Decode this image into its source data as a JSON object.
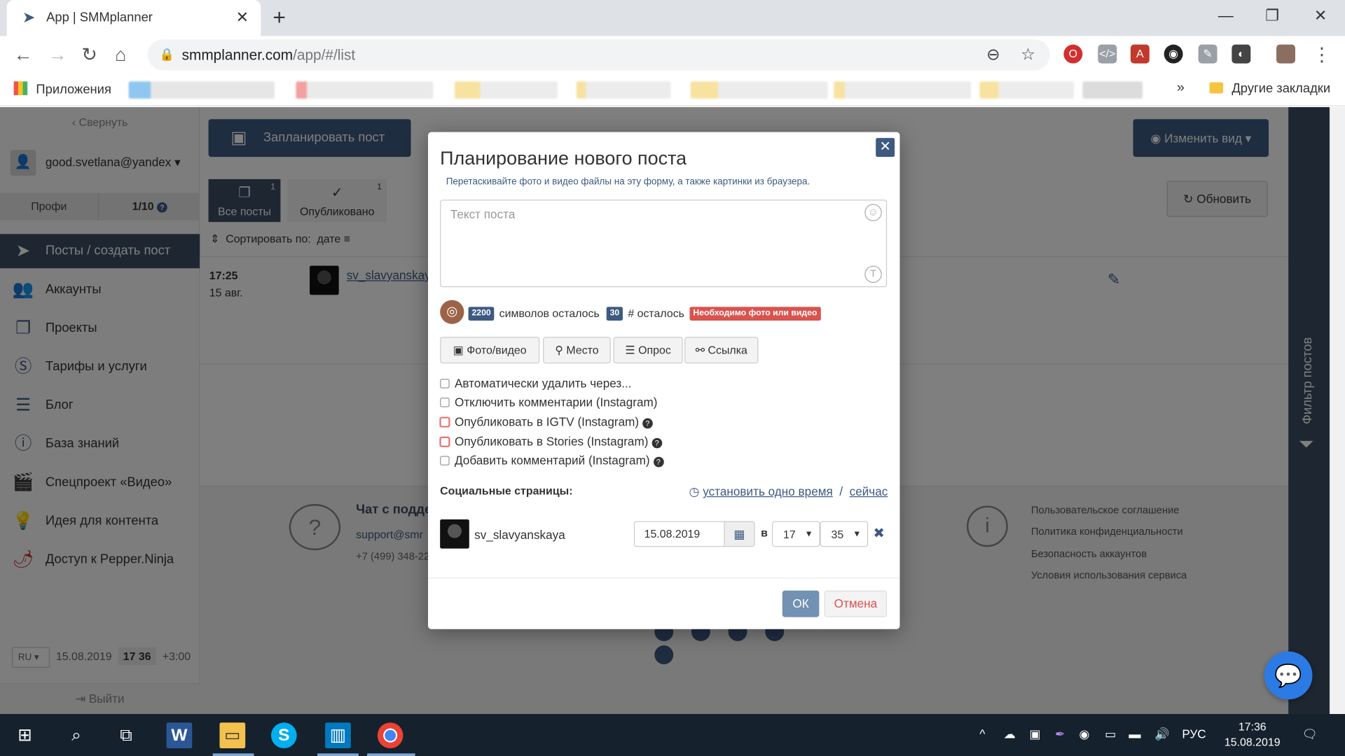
{
  "browser": {
    "tab_title": "App | SMMplanner",
    "url_host": "smmplanner.com",
    "url_path": "/app/#/list",
    "bookmarks": {
      "apps": "Приложения",
      "more": "»",
      "other": "Другие закладки"
    }
  },
  "sidebar": {
    "collapse": "Свернуть",
    "user": "good.svetlana@yandex",
    "plan_name": "Профи",
    "plan_count": "1/10",
    "menu": [
      {
        "label": "Посты / создать пост",
        "icon": "paper-plane-icon"
      },
      {
        "label": "Аккаунты",
        "icon": "users-icon"
      },
      {
        "label": "Проекты",
        "icon": "folders-icon"
      },
      {
        "label": "Тарифы и услуги",
        "icon": "dollar-icon"
      },
      {
        "label": "Блог",
        "icon": "blog-icon"
      },
      {
        "label": "База знаний",
        "icon": "info-icon"
      },
      {
        "label": "Спецпроект «Видео»",
        "icon": "clapper-icon"
      },
      {
        "label": "Идея для контента",
        "icon": "lightbulb-icon"
      },
      {
        "label": "Доступ к Pepper.Ninja",
        "icon": "pepper-icon"
      }
    ],
    "lang": "RU",
    "date": "15.08.2019",
    "time": "17 36",
    "tz": "+3:00",
    "logout": "Выйти"
  },
  "main": {
    "plan_button": "Запланировать пост",
    "view_button": "Изменить вид",
    "refresh_button": "Обновить",
    "tabs": [
      {
        "label": "Все посты",
        "count": "1"
      },
      {
        "label": "Опубликовано",
        "count": "1"
      }
    ],
    "sort_label": "Сортировать по:",
    "sort_value": "дате",
    "post": {
      "time": "17:25",
      "date": "15 авг.",
      "account": "sv_slavyanskaya"
    },
    "footer": {
      "chat": "Чат с подде",
      "mail": "support@smr",
      "tel": "+7 (499) 348-22",
      "links": [
        "Пользовательское соглашение",
        "Политика конфиденциальности",
        "Безопасность аккаунтов",
        "Условия использования сервиса"
      ]
    },
    "filter_label": "Фильтр постов"
  },
  "modal": {
    "title": "Планирование нового поста",
    "hint": "Перетаскивайте фото и видео файлы на эту форму, а также картинки из браузера.",
    "placeholder": "Текст поста",
    "chars_count": "2200",
    "chars_label": "символов осталось",
    "hash_count": "30",
    "hash_label": "# осталось",
    "need_media": "Необходимо фото или видео",
    "buttons": [
      "Фото/видео",
      "Место",
      "Опрос",
      "Ссылка"
    ],
    "options": [
      "Автоматически удалить через...",
      "Отключить комментарии (Instagram)",
      "Опубликовать в IGTV (Instagram)",
      "Опубликовать в Stories (Instagram)",
      "Добавить комментарий (Instagram)"
    ],
    "social_title": "Социальные страницы:",
    "set_time": "установить одно время",
    "slash": "/",
    "now": "сейчас",
    "account": "sv_slavyanskaya",
    "date": "15.08.2019",
    "at": "в",
    "hour": "17",
    "minute": "35",
    "ok": "ОК",
    "cancel": "Отмена"
  },
  "taskbar": {
    "lang": "РУС",
    "time": "17:36",
    "date": "15.08.2019"
  },
  "colors": {
    "brand": "#3d5a80",
    "danger": "#d9534f",
    "dark_panel": "#3d4d63"
  }
}
